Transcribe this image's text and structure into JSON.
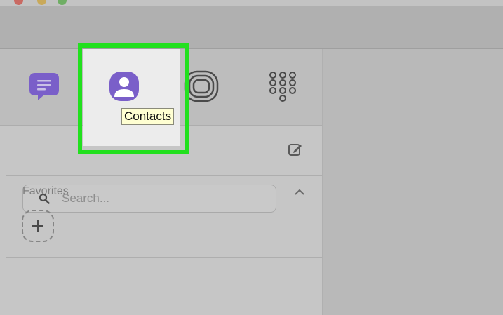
{
  "tooltip": {
    "text": "Contacts"
  },
  "search": {
    "placeholder": "Search..."
  },
  "favorites": {
    "title": "Favorites"
  },
  "icons": {
    "chats": "chat-bubble-icon",
    "contacts": "contacts-icon",
    "stories": "stories-rings-icon",
    "keypad": "dialpad-icon",
    "search": "search-icon",
    "compose": "compose-icon",
    "collapse": "chevron-up-icon",
    "add": "plus-icon"
  },
  "colors": {
    "accent": "#7a5fc9",
    "highlight": "#22e01e",
    "tooltip_bg": "#ffffd2"
  }
}
